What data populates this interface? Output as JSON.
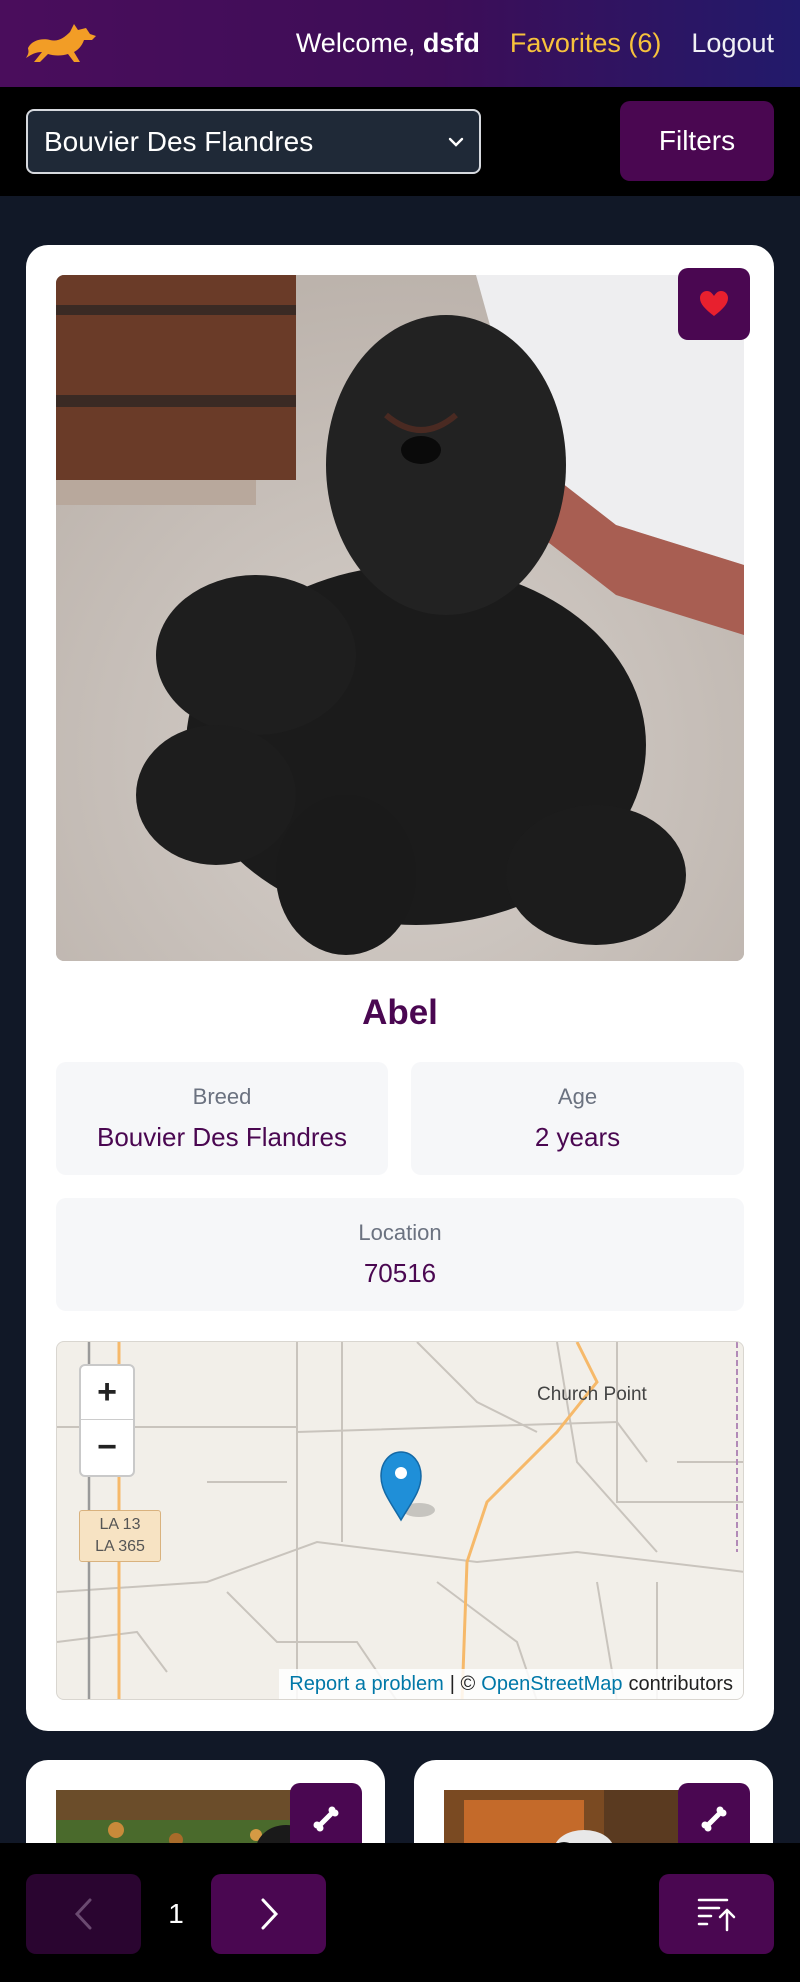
{
  "header": {
    "logo_icon": "running-dog-icon",
    "welcome_prefix": "Welcome, ",
    "username": "dsfd",
    "favorites_label": "Favorites (6)",
    "logout_label": "Logout",
    "accent_color": "#f7c23c"
  },
  "toolbar": {
    "breed_select_value": "Bouvier Des Flandres",
    "filters_label": "Filters"
  },
  "dog": {
    "name": "Abel",
    "breed_label": "Breed",
    "breed": "Bouvier Des Flandres",
    "age_label": "Age",
    "age": "2 years",
    "location_label": "Location",
    "location": "70516",
    "favorite_icon": "heart-icon"
  },
  "map": {
    "zoom_in": "+",
    "zoom_out": "−",
    "place_label": "Church Point",
    "road_label_1": "LA 13",
    "road_label_2": "LA 365",
    "attrib_report": "Report a problem",
    "attrib_sep": "| ©",
    "attrib_osm": "OpenStreetMap",
    "attrib_contrib": "contributors",
    "marker_icon": "map-pin-icon"
  },
  "pagination": {
    "page": "1",
    "prev_icon": "chevron-left-icon",
    "next_icon": "chevron-right-icon",
    "sort_icon": "sort-ascending-icon"
  },
  "colors": {
    "brand_purple": "#4a0751",
    "background": "#111827"
  }
}
